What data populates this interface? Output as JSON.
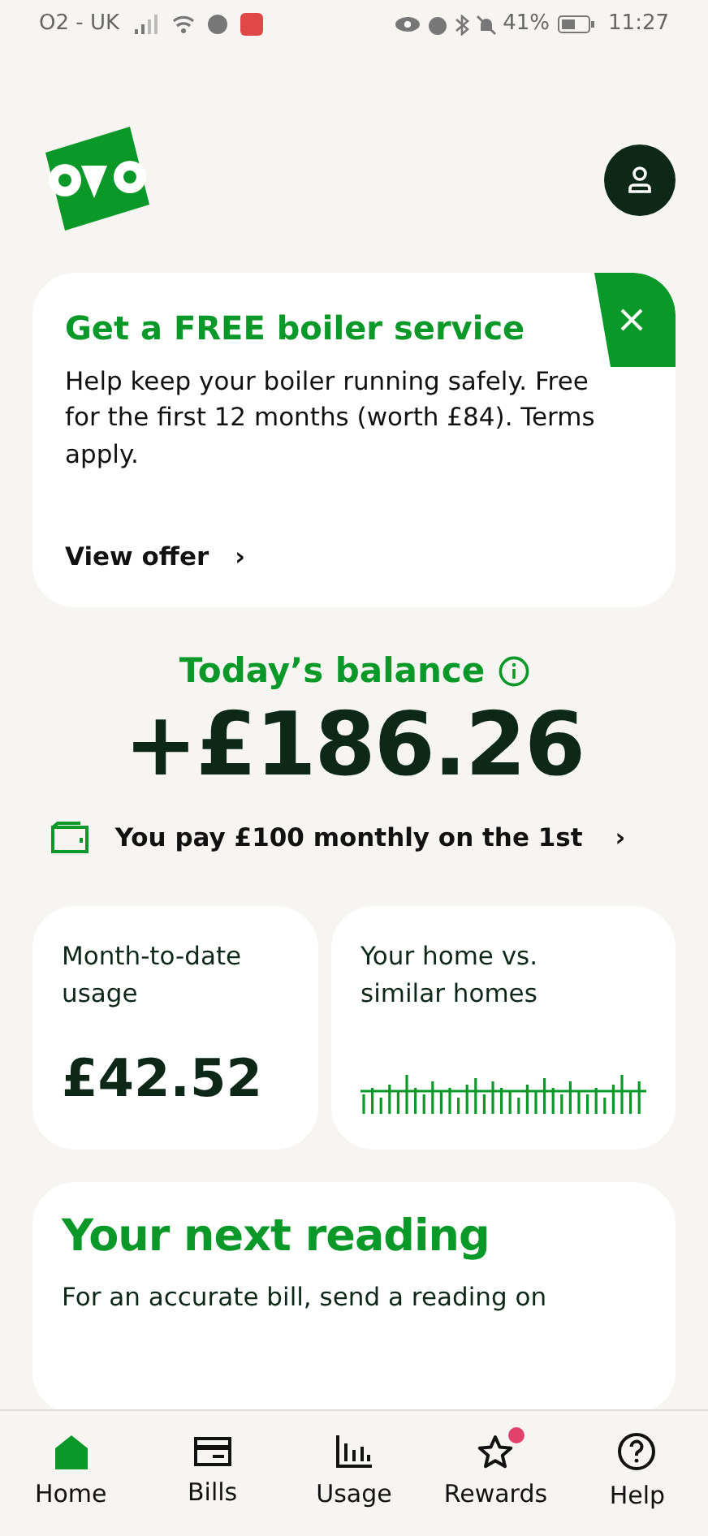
{
  "status_bar": {
    "carrier": "O2 - UK",
    "battery": "41%",
    "time": "11:27"
  },
  "promo": {
    "title": "Get a FREE boiler service",
    "body": "Help keep your boiler running safely. Free for the first 12 months (worth £84). Terms apply.",
    "link": "View offer",
    "chevron": "›"
  },
  "balance": {
    "label": "Today’s balance",
    "amount": "+£186.26",
    "payment": "You pay £100 monthly on the 1st",
    "chevron": "›"
  },
  "tiles": [
    {
      "kind": "amount",
      "title": "Month-to-date usage",
      "value": "£42.52"
    },
    {
      "kind": "spark",
      "title": "Your home vs. similar homes"
    }
  ],
  "reading": {
    "title": "Your next reading",
    "body": "For an accurate bill, send a reading on"
  },
  "nav": [
    {
      "label": "Home",
      "kind": "home",
      "selected": true,
      "badge": false
    },
    {
      "label": "Bills",
      "kind": "bills",
      "selected": false,
      "badge": false
    },
    {
      "label": "Usage",
      "kind": "usage",
      "selected": false,
      "badge": false
    },
    {
      "label": "Rewards",
      "kind": "rewards",
      "selected": false,
      "badge": true
    },
    {
      "label": "Help",
      "kind": "help",
      "selected": false,
      "badge": false
    }
  ]
}
